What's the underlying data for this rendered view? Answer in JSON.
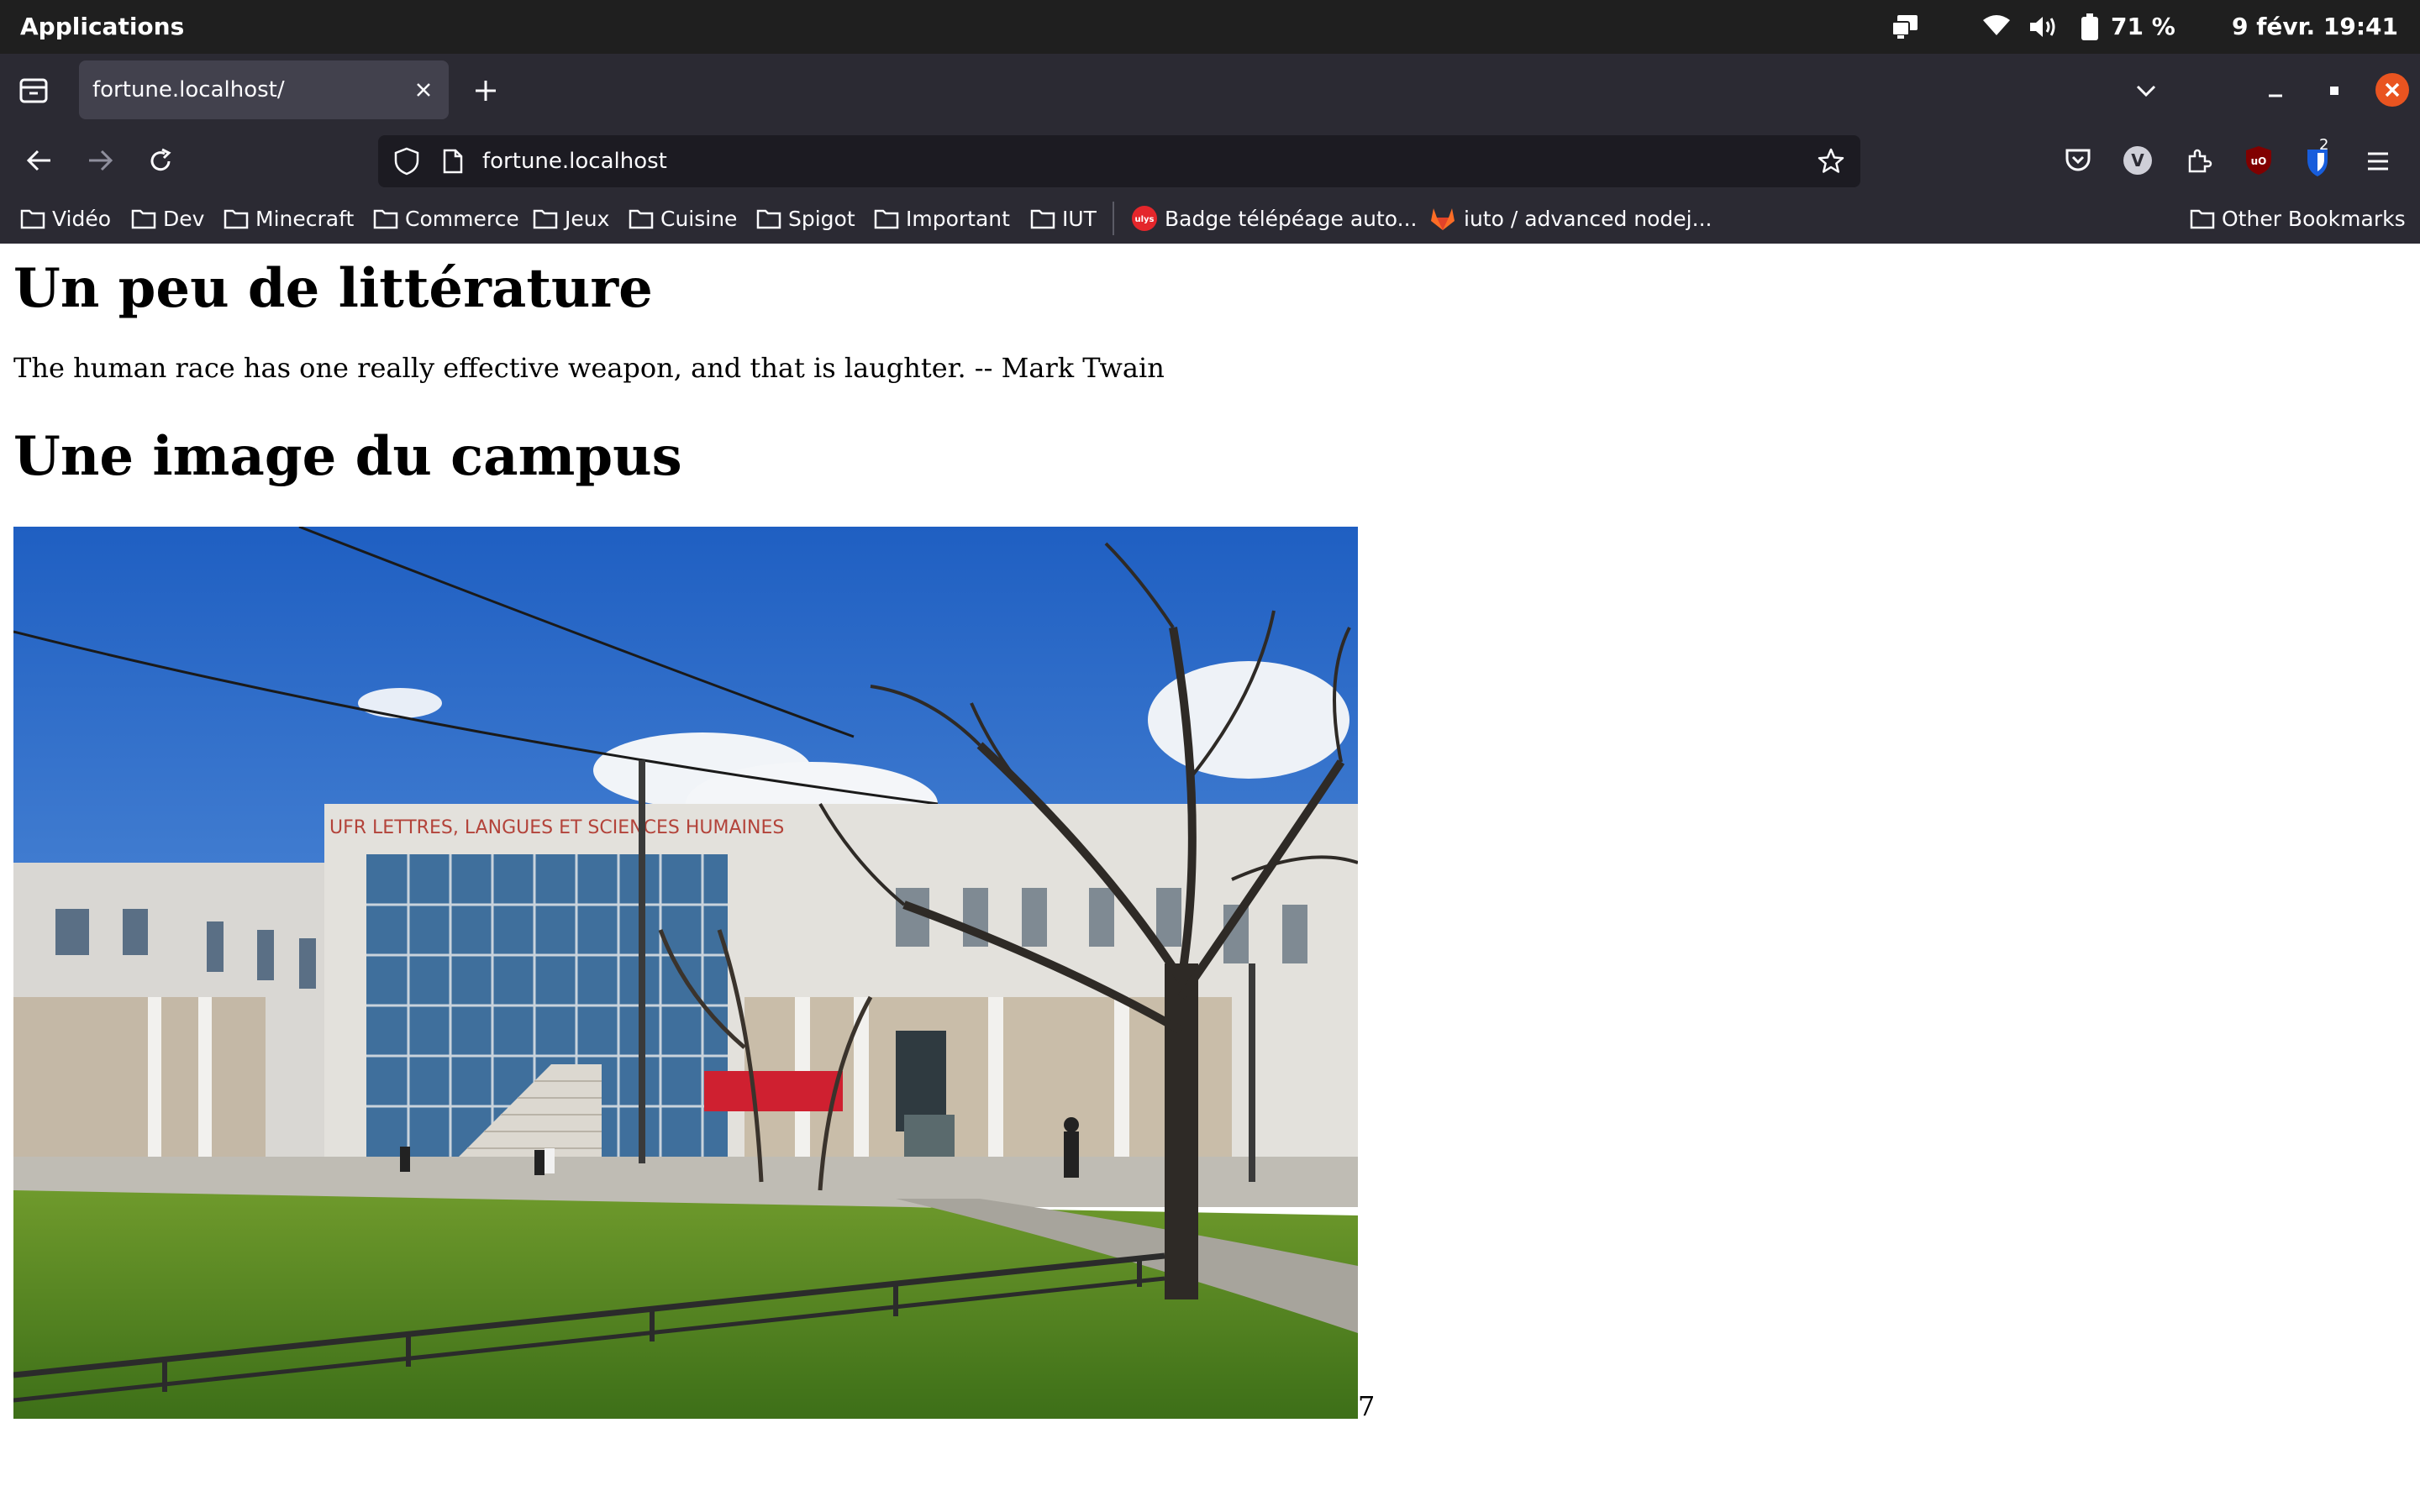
{
  "system": {
    "apps_label": "Applications",
    "battery": "71 %",
    "clock": "9 févr.  19:41"
  },
  "browser": {
    "tab": {
      "title": "fortune.localhost/"
    },
    "url": "fortune.localhost",
    "bookmarks": [
      {
        "label": "Vidéo",
        "icon": "folder-icon"
      },
      {
        "label": "Dev",
        "icon": "folder-icon"
      },
      {
        "label": "Minecraft",
        "icon": "folder-icon"
      },
      {
        "label": "Commerce",
        "icon": "folder-icon"
      },
      {
        "label": "Jeux",
        "icon": "folder-icon"
      },
      {
        "label": "Cuisine",
        "icon": "folder-icon"
      },
      {
        "label": "Spigot",
        "icon": "folder-icon"
      },
      {
        "label": "Important",
        "icon": "folder-icon"
      },
      {
        "label": "IUT",
        "icon": "folder-icon"
      },
      {
        "label": "Badge télépéage auto...",
        "icon": "ulys-favicon"
      },
      {
        "label": "iuto / advanced nodej...",
        "icon": "gitlab-favicon"
      }
    ],
    "other_bookmarks": "Other Bookmarks",
    "ublock_count": "2",
    "extension_avatar": "V",
    "colors": {
      "chrome": "#2b2a33",
      "urlbar": "#1c1b22",
      "topbar": "#1f1f1f",
      "close_button": "#e95420"
    }
  },
  "page": {
    "heading1": "Un peu de littérature",
    "quote": "The human race has one really effective weapon, and that is laughter. -- Mark Twain",
    "heading2": "Une image du campus",
    "building_sign": "UFR LETTRES, LANGUES ET SCIENCES HUMAINES",
    "counter": "7"
  }
}
